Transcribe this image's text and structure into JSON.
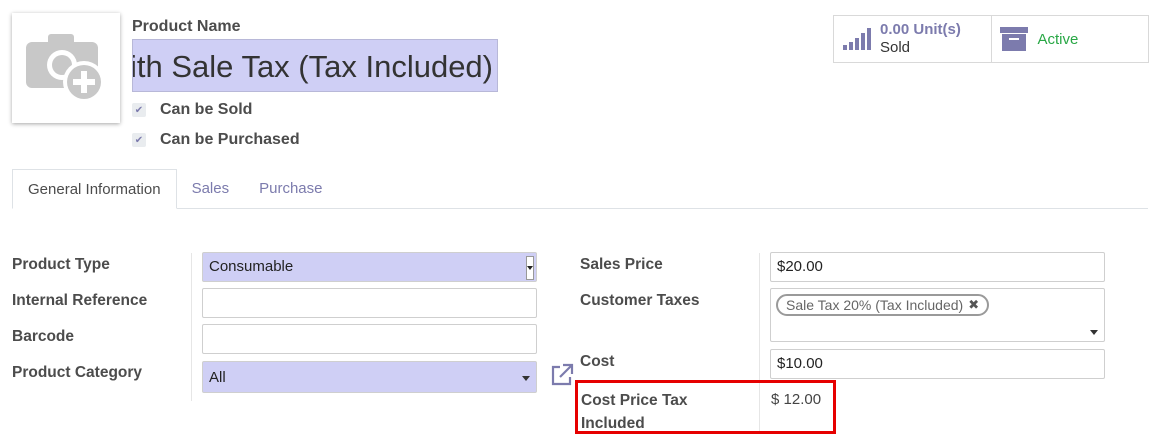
{
  "header": {
    "name_label": "Product Name",
    "name_value": "Product with Sale Tax (Tax Included)",
    "can_be_sold": "Can be Sold",
    "can_be_purchased": "Can be Purchased"
  },
  "smart_buttons": {
    "sold_value": "0.00",
    "sold_unit": "Unit(s)",
    "sold_label": "Sold",
    "active_label": "Active"
  },
  "tabs": [
    {
      "label": "General Information"
    },
    {
      "label": "Sales"
    },
    {
      "label": "Purchase"
    }
  ],
  "left_form": {
    "product_type_label": "Product Type",
    "product_type_value": "Consumable",
    "internal_ref_label": "Internal Reference",
    "internal_ref_value": "",
    "barcode_label": "Barcode",
    "barcode_value": "",
    "category_label": "Product Category",
    "category_value": "All"
  },
  "right_form": {
    "sales_price_label": "Sales Price",
    "sales_price_value": "$20.00",
    "customer_taxes_label": "Customer Taxes",
    "customer_tax_tag": "Sale Tax 20% (Tax Included)",
    "cost_label": "Cost",
    "cost_value": "$10.00",
    "cost_tax_label": "Cost Price Tax Included",
    "cost_tax_value": "$ 12.00"
  },
  "colors": {
    "accent": "#7c7bad",
    "input_highlight": "#cfcff5",
    "active_green": "#28a745",
    "annotation_red": "#e60000"
  }
}
